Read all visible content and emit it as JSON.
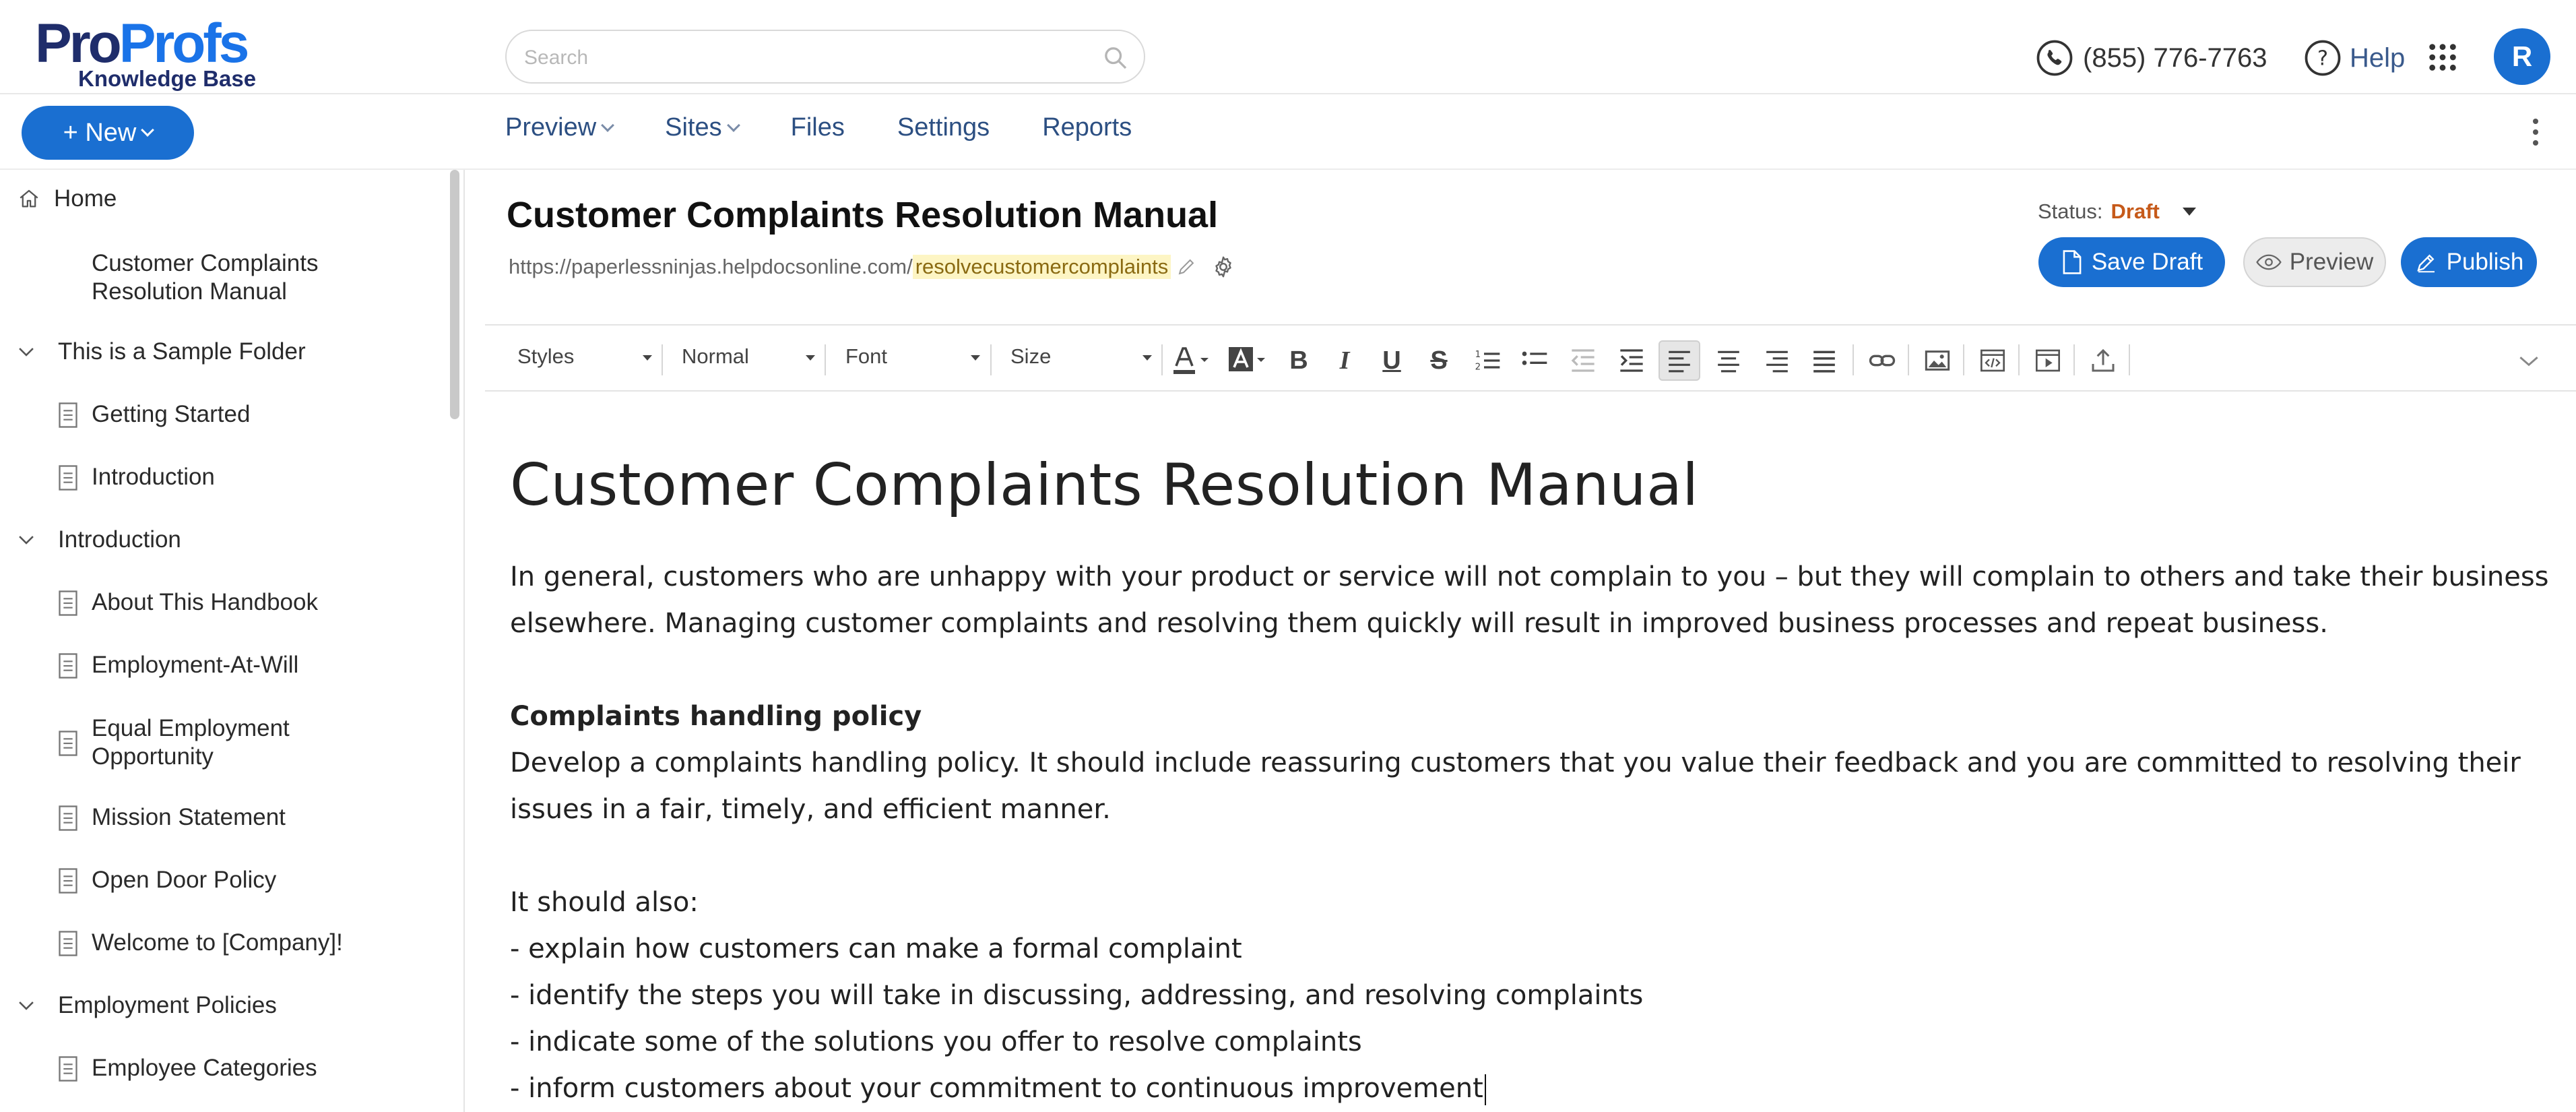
{
  "header": {
    "logo_top_left": "Pro",
    "logo_top_right": "Profs",
    "logo_sub": "Knowledge Base",
    "search_placeholder": "Search",
    "phone": "(855) 776-7763",
    "help": "Help",
    "avatar_initial": "R"
  },
  "toolbar_top": {
    "new_label": "+ New",
    "nav": [
      "Preview",
      "Sites",
      "Files",
      "Settings",
      "Reports"
    ]
  },
  "sidebar": {
    "items": [
      {
        "label": "Home",
        "kind": "home"
      },
      {
        "label": "Customer Complaints",
        "label2": "Resolution Manual",
        "kind": "page"
      },
      {
        "label": "This is a Sample Folder",
        "kind": "folder"
      },
      {
        "label": "Getting Started",
        "kind": "doc"
      },
      {
        "label": "Introduction",
        "kind": "doc"
      },
      {
        "label": "Introduction",
        "kind": "folder"
      },
      {
        "label": "About This Handbook",
        "kind": "doc"
      },
      {
        "label": "Employment-At-Will",
        "kind": "doc"
      },
      {
        "label": "Equal Employment",
        "label2": "Opportunity",
        "kind": "doc"
      },
      {
        "label": "Mission Statement",
        "kind": "doc"
      },
      {
        "label": "Open Door Policy",
        "kind": "doc"
      },
      {
        "label": "Welcome to [Company]!",
        "kind": "doc"
      },
      {
        "label": "Employment Policies",
        "kind": "folder"
      },
      {
        "label": "Employee Categories",
        "kind": "doc"
      }
    ]
  },
  "article": {
    "title": "Customer Complaints Resolution Manual",
    "url_base": "https://paperlessninjas.helpdocsonline.com/",
    "url_slug": "resolvecustomercomplaints",
    "status_label": "Status:",
    "status_value": "Draft",
    "save_label": "Save Draft",
    "preview_label": "Preview",
    "publish_label": "Publish"
  },
  "editor_toolbar": {
    "styles": "Styles",
    "format": "Normal",
    "font": "Font",
    "size": "Size"
  },
  "content": {
    "heading": "Customer Complaints Resolution Manual",
    "para1_line1": "In general, customers who are unhappy with your product or service will not complain to you – but they will complain to others and take their business",
    "para1_line2": "elsewhere. Managing customer complaints and resolving them quickly will result in improved business processes and repeat business.",
    "subheading": "Complaints handling policy",
    "para2_line1": "Develop a complaints handling policy. It should include reassuring customers that you value their feedback and you are committed to resolving their",
    "para2_line2": "issues in a fair, timely, and efficient manner.",
    "list_intro": "It should also:",
    "bullets": [
      "- explain how customers can make a formal complaint",
      "- identify the steps you will take in discussing, addressing, and resolving complaints",
      "- indicate some of the solutions you offer to resolve complaints",
      "- inform customers about your commitment to continuous improvement"
    ]
  },
  "colors": {
    "brand_blue": "#1a6fd1",
    "nav_blue": "#2c4f82",
    "draft_orange": "#c65a1a",
    "slug_highlight": "#fdf5c4"
  }
}
